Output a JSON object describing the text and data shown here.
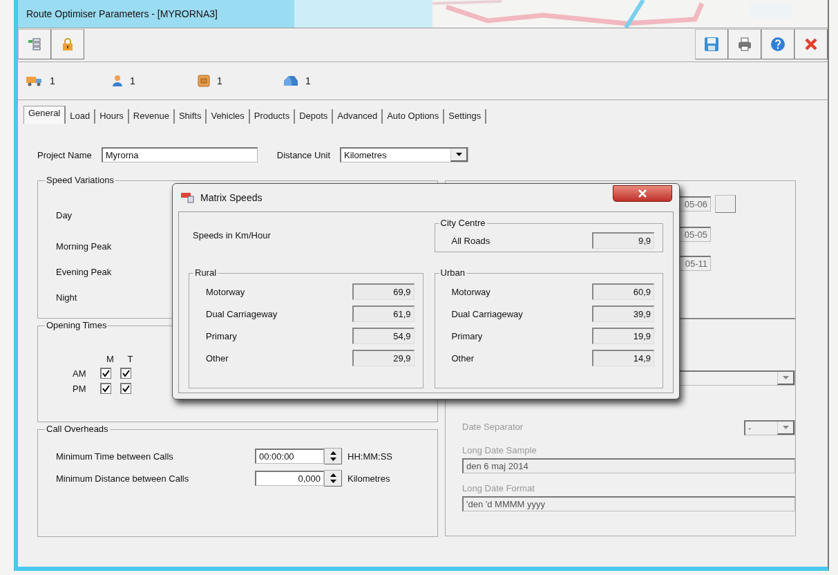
{
  "window": {
    "title": "Route Optimiser Parameters - [MYRORNA3]"
  },
  "counts": [
    {
      "kind": "vehicle",
      "value": "1"
    },
    {
      "kind": "driver",
      "value": "1"
    },
    {
      "kind": "product",
      "value": "1"
    },
    {
      "kind": "depot",
      "value": "1"
    }
  ],
  "tabs": [
    {
      "label": "General",
      "selected": true
    },
    {
      "label": "Load",
      "selected": false
    },
    {
      "label": "Hours",
      "selected": false
    },
    {
      "label": "Revenue",
      "selected": false
    },
    {
      "label": "Shifts",
      "selected": false
    },
    {
      "label": "Vehicles",
      "selected": false
    },
    {
      "label": "Products",
      "selected": false
    },
    {
      "label": "Depots",
      "selected": false
    },
    {
      "label": "Advanced",
      "selected": false
    },
    {
      "label": "Auto Options",
      "selected": false
    },
    {
      "label": "Settings",
      "selected": false
    }
  ],
  "project_name": {
    "label": "Project Name",
    "value": "Myrorna"
  },
  "distance_unit": {
    "label": "Distance Unit",
    "value": "Kilometres"
  },
  "speed_variations": {
    "title": "Speed Variations",
    "rows": [
      "Day",
      "Morning Peak",
      "Evening Peak",
      "Night"
    ]
  },
  "opening_times": {
    "title": "Opening Times",
    "days": [
      "M",
      "T"
    ],
    "rows": [
      {
        "label": "AM",
        "checks": [
          true,
          true
        ]
      },
      {
        "label": "PM",
        "checks": [
          true,
          true
        ]
      }
    ]
  },
  "call_overheads": {
    "title": "Call  Overheads",
    "rows": [
      {
        "label": "Minimum Time between Calls",
        "value": "00:00:00",
        "kind": "time",
        "unit": "HH:MM:SS"
      },
      {
        "label": "Minimum Distance between Calls",
        "value": "0,000",
        "kind": "distance",
        "unit": "Kilometres"
      }
    ]
  },
  "planning_dates": {
    "values": [
      "05-06",
      "05-05",
      "05-11"
    ]
  },
  "date_settings": {
    "disabled": true,
    "separator": {
      "label": "Date Separator",
      "value": "-"
    },
    "long_sample": {
      "label": "Long Date Sample",
      "value": "den 6 maj 2014"
    },
    "long_format": {
      "label": "Long Date Format",
      "value": "'den 'd MMMM yyyy"
    }
  },
  "matrix_speeds": {
    "title": "Matrix Speeds",
    "note": "Speeds in Km/Hour",
    "city_centre": {
      "title": "City Centre",
      "rows": [
        {
          "label": "All Roads",
          "value": "9,9"
        }
      ]
    },
    "rural": {
      "title": "Rural",
      "rows": [
        {
          "label": "Motorway",
          "value": "69,9"
        },
        {
          "label": "Dual Carriageway",
          "value": "61,9"
        },
        {
          "label": "Primary",
          "value": "54,9"
        },
        {
          "label": "Other",
          "value": "29,9"
        }
      ]
    },
    "urban": {
      "title": "Urban",
      "rows": [
        {
          "label": "Motorway",
          "value": "60,9"
        },
        {
          "label": "Dual Carriageway",
          "value": "39,9"
        },
        {
          "label": "Primary",
          "value": "19,9"
        },
        {
          "label": "Other",
          "value": "14,9"
        }
      ]
    }
  }
}
